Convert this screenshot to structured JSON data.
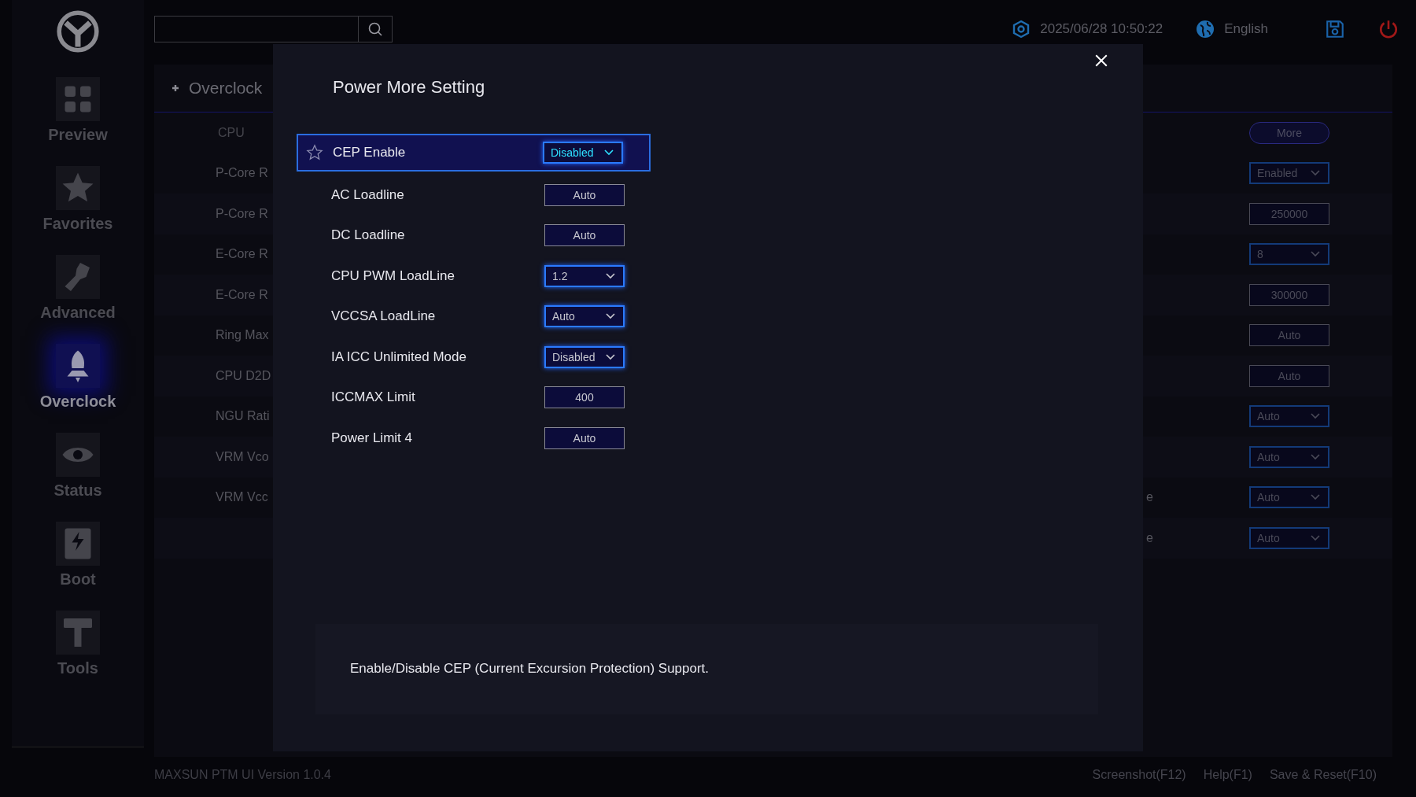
{
  "header": {
    "datetime": "2025/06/28 10:50:22",
    "language": "English"
  },
  "sidebar": {
    "items": [
      {
        "label": "Preview",
        "selected": false
      },
      {
        "label": "Favorites",
        "selected": false
      },
      {
        "label": "Advanced",
        "selected": false
      },
      {
        "label": "Overclock",
        "selected": true
      },
      {
        "label": "Status",
        "selected": false
      },
      {
        "label": "Boot",
        "selected": false
      },
      {
        "label": "Tools",
        "selected": false
      }
    ]
  },
  "page": {
    "title": "Overclock",
    "section": "CPU",
    "more_button": "More",
    "rows": [
      {
        "label": "P-Core R",
        "kind": "dropdown",
        "value": "Enabled"
      },
      {
        "label": "P-Core R",
        "kind": "field",
        "value": "250000"
      },
      {
        "label": "E-Core R",
        "kind": "dropdown",
        "value": "8"
      },
      {
        "label": "E-Core R",
        "kind": "field",
        "value": "300000"
      },
      {
        "label": "Ring Max",
        "kind": "field",
        "value": "Auto"
      },
      {
        "label": "CPU D2D",
        "kind": "field",
        "value": "Auto"
      },
      {
        "label": "NGU Rati",
        "kind": "dropdown",
        "value": "Auto"
      },
      {
        "label": "VRM Vco",
        "kind": "dropdown",
        "value": "Auto"
      },
      {
        "label": "VRM Vcc",
        "label_tail": "e",
        "kind": "dropdown",
        "value": "Auto"
      },
      {
        "label_tail": "e",
        "kind": "dropdown",
        "value": "Auto"
      }
    ]
  },
  "dialog": {
    "title": "Power More Setting",
    "rows": [
      {
        "label": "CEP Enable",
        "kind": "dropdown",
        "value": "Disabled",
        "selected": true
      },
      {
        "label": "AC Loadline",
        "kind": "field",
        "value": "Auto",
        "selected": false
      },
      {
        "label": "DC Loadline",
        "kind": "field",
        "value": "Auto",
        "selected": false
      },
      {
        "label": "CPU PWM LoadLine",
        "kind": "dropdown",
        "value": "1.2",
        "selected": false
      },
      {
        "label": "VCCSA LoadLine",
        "kind": "dropdown",
        "value": "Auto",
        "selected": false
      },
      {
        "label": "IA ICC Unlimited Mode",
        "kind": "dropdown",
        "value": "Disabled",
        "selected": false
      },
      {
        "label": "ICCMAX Limit",
        "kind": "field",
        "value": "400",
        "selected": false
      },
      {
        "label": "Power Limit 4",
        "kind": "field",
        "value": "Auto",
        "selected": false
      }
    ],
    "description": "Enable/Disable CEP (Current Excursion Protection) Support."
  },
  "footer": {
    "version": "MAXSUN PTM UI Version 1.0.4",
    "links": [
      "Screenshot(F12)",
      "Help(F1)",
      "Save & Reset(F10)"
    ]
  }
}
